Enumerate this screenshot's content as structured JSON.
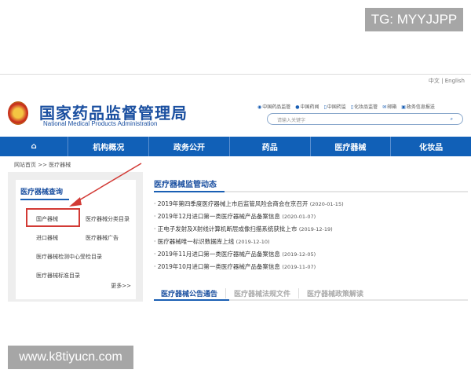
{
  "watermarks": {
    "top": "TG: MYYJJPP",
    "bottom": "www.k8tiyucn.com"
  },
  "lang": "中文 | English",
  "header": {
    "title": "国家药品监督管理局",
    "subtitle": "National Medical Products Administration",
    "links": [
      {
        "icon": "weibo-icon",
        "label": "中国药品监管"
      },
      {
        "icon": "wechat-icon",
        "label": "中国药闻"
      },
      {
        "icon": "mobile-icon",
        "label": "中国药监"
      },
      {
        "icon": "mobile-icon",
        "label": "化妆品监管"
      },
      {
        "icon": "mail-icon",
        "label": "邮箱"
      },
      {
        "icon": "monitor-icon",
        "label": "政务信息报送"
      }
    ],
    "search_placeholder": "请输入关键字"
  },
  "nav": [
    "机构概况",
    "政务公开",
    "药品",
    "医疗器械",
    "化妆品"
  ],
  "breadcrumb": "网站首页 >> 医疗器械",
  "sidebar": {
    "title": "医疗器械查询",
    "items": [
      "国产器械",
      "医疗器械分类目录",
      "进口器械",
      "医疗器械广告",
      "医疗器械检测中心受检目录",
      "医疗器械标准目录"
    ],
    "more": "更多>>"
  },
  "main": {
    "title": "医疗器械监管动态",
    "news": [
      {
        "t": "2019年第四季度医疗器械上市后监管风险会商会在京召开",
        "d": "(2020-01-15)"
      },
      {
        "t": "2019年12月进口第一类医疗器械产品备案信息",
        "d": "(2020-01-07)"
      },
      {
        "t": "正电子发射及X射线计算机断层成像扫描系统获批上市",
        "d": "(2019-12-19)"
      },
      {
        "t": "医疗器械唯一标识数据库上线",
        "d": "(2019-12-10)"
      },
      {
        "t": "2019年11月进口第一类医疗器械产品备案信息",
        "d": "(2019-12-05)"
      },
      {
        "t": "2019年10月进口第一类医疗器械产品备案信息",
        "d": "(2019-11-07)"
      }
    ],
    "tabs": [
      "医疗器械公告通告",
      "医疗器械法规文件",
      "医疗器械政策解读"
    ]
  },
  "colors": {
    "brand": "#1160b7",
    "highlight": "#d23a35"
  }
}
